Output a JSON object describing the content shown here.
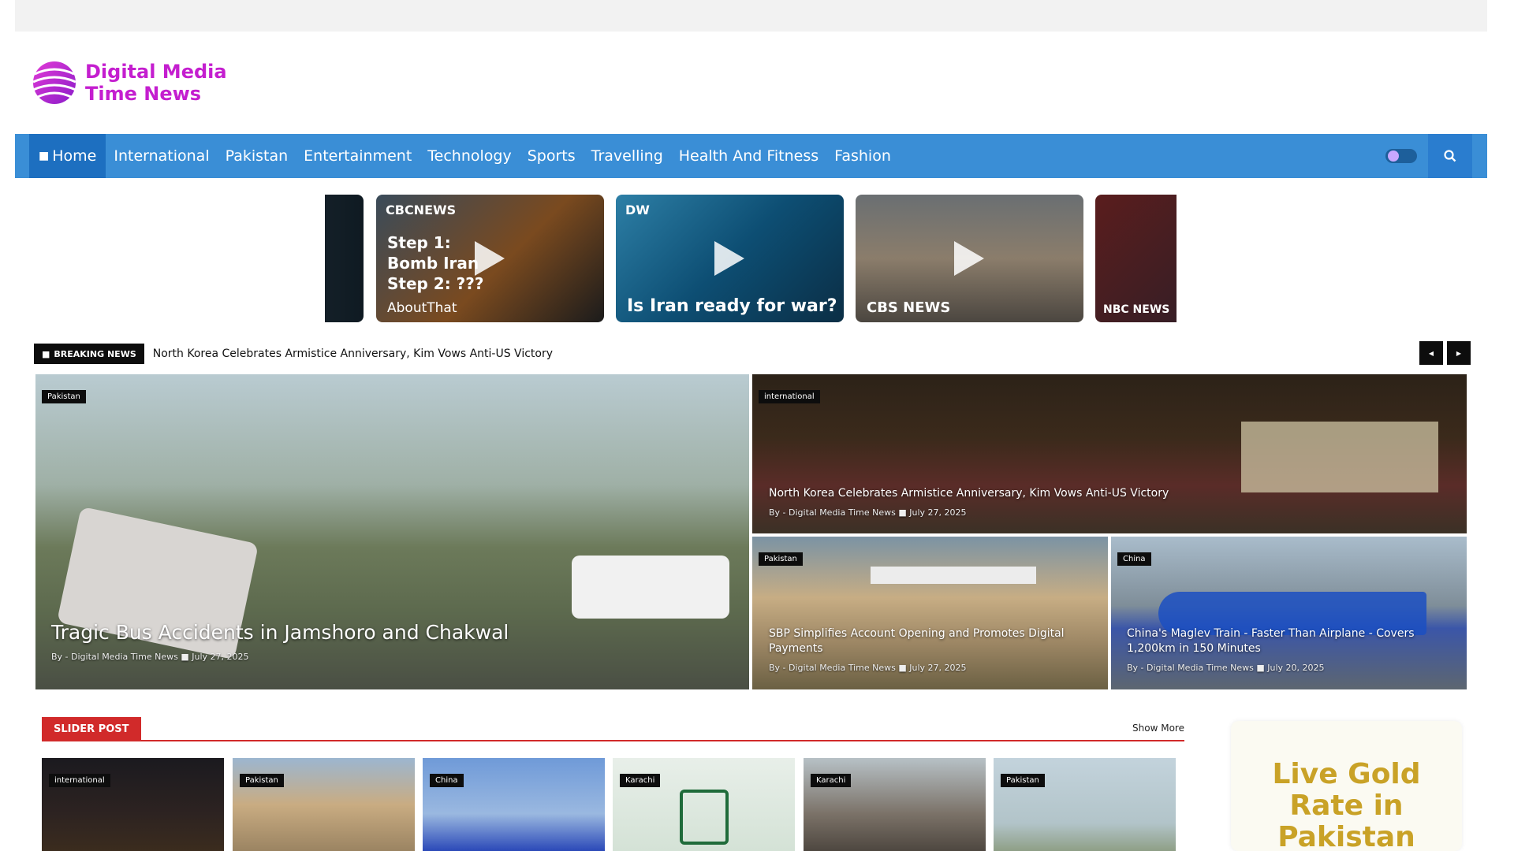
{
  "site": {
    "logo_line1": "Digital Media",
    "logo_line2": "Time News",
    "accent": "#3a8ed6",
    "logo_color": "#c41ecf"
  },
  "nav": {
    "items": [
      {
        "label": "Home",
        "icon": "home-icon",
        "active": true
      },
      {
        "label": "International"
      },
      {
        "label": "Pakistan"
      },
      {
        "label": "Entertainment"
      },
      {
        "label": "Technology"
      },
      {
        "label": "Sports"
      },
      {
        "label": "Travelling"
      },
      {
        "label": "Health And Fitness"
      },
      {
        "label": "Fashion"
      }
    ],
    "dark_mode_icon": "dark-mode-toggle",
    "search_icon": "search-icon"
  },
  "videos": [
    {
      "brand": "",
      "caption": ""
    },
    {
      "brand": "CBCNEWS",
      "caption": "Step 1: Bomb Iran Step 2: ???",
      "footer": "AboutThat"
    },
    {
      "brand": "DW",
      "caption": "Is Iran ready for war?"
    },
    {
      "brand": "",
      "caption": "",
      "footer": "CBS NEWS"
    },
    {
      "brand": "",
      "caption": "",
      "footer": "NBC NEWS"
    }
  ],
  "breaking": {
    "badge": "BREAKING NEWS",
    "text": "North Korea Celebrates Armistice Anniversary, Kim Vows Anti-US Victory"
  },
  "featured": [
    {
      "category": "Pakistan",
      "title": "Tragic Bus Accidents in Jamshoro and Chakwal",
      "author": "By - Digital Media Time News",
      "date": "July 27, 2025"
    },
    {
      "category": "international",
      "title": "North Korea Celebrates Armistice Anniversary, Kim Vows Anti-US Victory",
      "author": "By - Digital Media Time News",
      "date": "July 27, 2025"
    },
    {
      "category": "Pakistan",
      "title": "SBP Simplifies Account Opening and Promotes Digital Payments",
      "author": "By - Digital Media Time News",
      "date": "July 27, 2025"
    },
    {
      "category": "China",
      "title": "China's Maglev Train - Faster Than Airplane - Covers 1,200km in 150 Minutes",
      "author": "By - Digital Media Time News",
      "date": "July 20, 2025"
    }
  ],
  "slider_section": {
    "title": "SLIDER POST",
    "show_more": "Show More",
    "items": [
      {
        "category": "international"
      },
      {
        "category": "Pakistan"
      },
      {
        "category": "China"
      },
      {
        "category": "Karachi"
      },
      {
        "category": "Karachi"
      },
      {
        "category": "Pakistan"
      }
    ]
  },
  "gold": {
    "title": "Live Gold Rate in Pakistan"
  }
}
